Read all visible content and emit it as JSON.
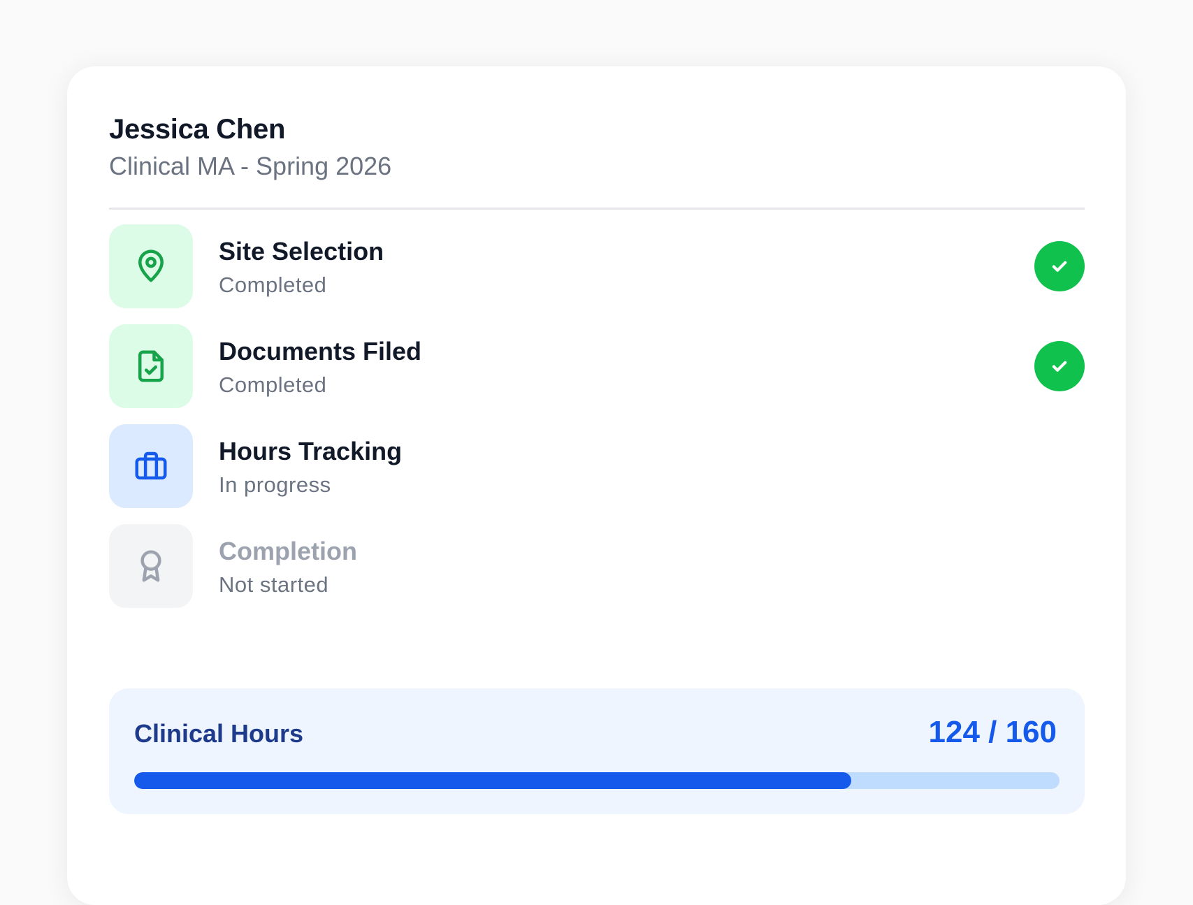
{
  "student": {
    "name": "Jessica Chen",
    "program": "Clinical MA - Spring 2026"
  },
  "steps": [
    {
      "title": "Site Selection",
      "status": "Completed",
      "icon": "map-pin-icon",
      "state": "done"
    },
    {
      "title": "Documents Filed",
      "status": "Completed",
      "icon": "file-check-icon",
      "state": "done"
    },
    {
      "title": "Hours Tracking",
      "status": "In progress",
      "icon": "briefcase-icon",
      "state": "active"
    },
    {
      "title": "Completion",
      "status": "Not started",
      "icon": "award-icon",
      "state": "pending"
    }
  ],
  "hours": {
    "label": "Clinical Hours",
    "value_text": "124 / 160",
    "completed": 124,
    "required": 160
  },
  "colors": {
    "done_bg": "#dcfce7",
    "done_fg": "#16a34a",
    "active_bg": "#dbeafe",
    "active_fg": "#155aeb",
    "pending_bg": "#f3f4f6",
    "pending_fg": "#9ca3af",
    "check": "#10c24d",
    "progress": "#155aeb",
    "progress_track": "#bfdbfe"
  }
}
